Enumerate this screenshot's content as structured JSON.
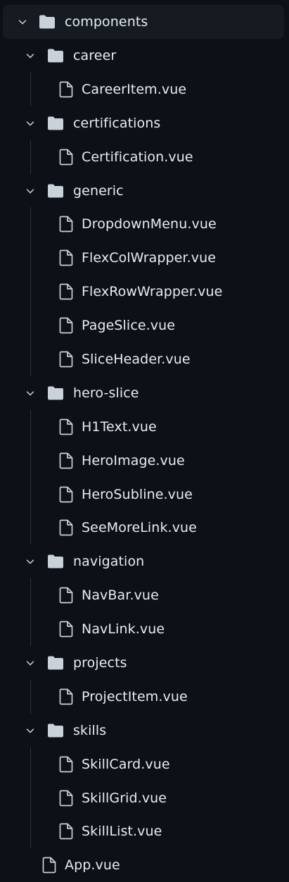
{
  "file_tree": {
    "root_folder": {
      "name": "components",
      "expanded": true
    },
    "folders": [
      {
        "name": "career",
        "expanded": true,
        "files": [
          "CareerItem.vue"
        ]
      },
      {
        "name": "certifications",
        "expanded": true,
        "files": [
          "Certification.vue"
        ]
      },
      {
        "name": "generic",
        "expanded": true,
        "files": [
          "DropdownMenu.vue",
          "FlexColWrapper.vue",
          "FlexRowWrapper.vue",
          "PageSlice.vue",
          "SliceHeader.vue"
        ]
      },
      {
        "name": "hero-slice",
        "expanded": true,
        "files": [
          "H1Text.vue",
          "HeroImage.vue",
          "HeroSubline.vue",
          "SeeMoreLink.vue"
        ]
      },
      {
        "name": "navigation",
        "expanded": true,
        "files": [
          "NavBar.vue",
          "NavLink.vue"
        ]
      },
      {
        "name": "projects",
        "expanded": true,
        "files": [
          "ProjectItem.vue"
        ]
      },
      {
        "name": "skills",
        "expanded": true,
        "files": [
          "SkillCard.vue",
          "SkillGrid.vue",
          "SkillList.vue"
        ]
      }
    ],
    "root_files": [
      "App.vue"
    ]
  },
  "icons": {
    "chevron": "chevron-down-icon",
    "folder": "folder-icon",
    "file": "file-icon"
  },
  "colors": {
    "background": "#0d1117",
    "selected_row": "#161b22",
    "text": "#e6edf3",
    "icon": "#c9d1d9",
    "guide_line": "#30363d"
  }
}
